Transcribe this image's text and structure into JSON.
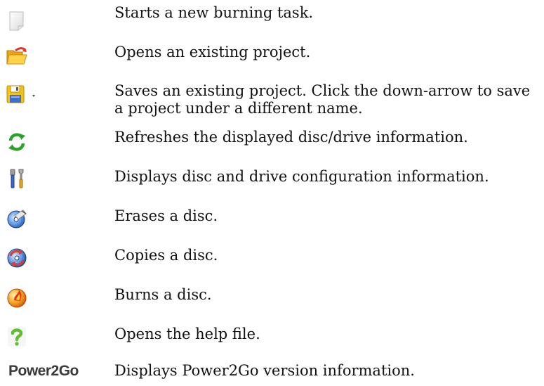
{
  "rows": [
    {
      "icon": "new-document-icon",
      "text": "Starts a new burning task."
    },
    {
      "icon": "open-folder-icon",
      "text": "Opens an existing project."
    },
    {
      "icon": "save-icon",
      "text": "Saves an existing project. Click the down-arrow to save a project under a different name."
    },
    {
      "icon": "refresh-icon",
      "text": "Refreshes the displayed disc/drive information."
    },
    {
      "icon": "tools-icon",
      "text": "Displays disc and drive configuration information."
    },
    {
      "icon": "erase-disc-icon",
      "text": "Erases a disc."
    },
    {
      "icon": "copy-disc-icon",
      "text": "Copies a disc."
    },
    {
      "icon": "burn-disc-icon",
      "text": "Burns a disc."
    },
    {
      "icon": "help-icon",
      "text": "Opens the help file."
    },
    {
      "icon": "power2go-logo",
      "text": "Displays Power2Go version information."
    }
  ],
  "logo": {
    "text": "Power2Go"
  }
}
